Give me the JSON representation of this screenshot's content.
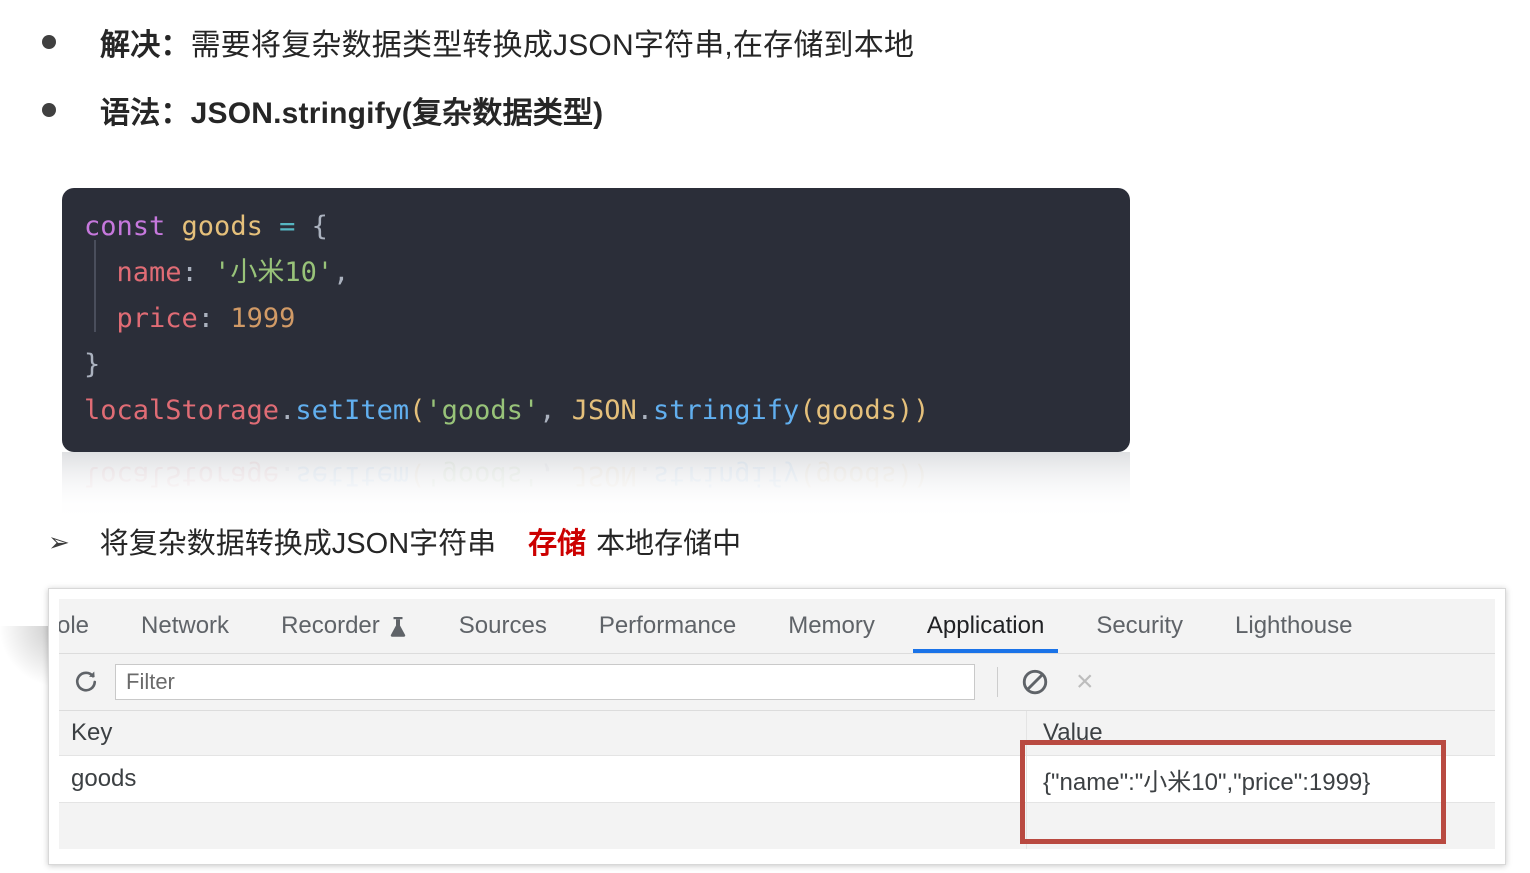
{
  "slide": {
    "bullets": [
      {
        "marker": "dot",
        "lead": "解决：",
        "rest": "需要将复杂数据类型转换成JSON字符串,在存储到本地",
        "bold_all": false
      },
      {
        "marker": "dot",
        "lead": "语法：",
        "rest": "JSON.stringify(复杂数据类型)",
        "bold_all": true
      }
    ],
    "sub_bullet": {
      "marker": "➢",
      "before": "将复杂数据转换成JSON字符串",
      "highlight": "存储",
      "highlight_color": "#CC0000",
      "after": "本地存储中"
    }
  },
  "code": {
    "language": "javascript",
    "background": "#2B2E39",
    "lines": [
      {
        "tokens": [
          {
            "t": "const",
            "c": "tok-kw"
          },
          {
            "t": " ",
            "c": "tok-punct"
          },
          {
            "t": "goods",
            "c": "tok-var"
          },
          {
            "t": " ",
            "c": "tok-punct"
          },
          {
            "t": "=",
            "c": "tok-op"
          },
          {
            "t": " ",
            "c": "tok-punct"
          },
          {
            "t": "{",
            "c": "tok-punct"
          }
        ]
      },
      {
        "tokens": [
          {
            "t": "  ",
            "c": "tok-punct"
          },
          {
            "t": "name",
            "c": "tok-prop"
          },
          {
            "t": ": ",
            "c": "tok-punct"
          },
          {
            "t": "'小米10'",
            "c": "tok-str"
          },
          {
            "t": ",",
            "c": "tok-punct"
          }
        ]
      },
      {
        "tokens": [
          {
            "t": "  ",
            "c": "tok-punct"
          },
          {
            "t": "price",
            "c": "tok-prop"
          },
          {
            "t": ": ",
            "c": "tok-punct"
          },
          {
            "t": "1999",
            "c": "tok-num"
          }
        ]
      },
      {
        "tokens": [
          {
            "t": "}",
            "c": "tok-punct"
          }
        ]
      },
      {
        "tokens": [
          {
            "t": "localStorage",
            "c": "tok-obj"
          },
          {
            "t": ".",
            "c": "tok-dot"
          },
          {
            "t": "setItem",
            "c": "tok-fn"
          },
          {
            "t": "(",
            "c": "tok-var"
          },
          {
            "t": "'goods'",
            "c": "tok-str"
          },
          {
            "t": ", ",
            "c": "tok-punct"
          },
          {
            "t": "JSON",
            "c": "tok-var"
          },
          {
            "t": ".",
            "c": "tok-dot"
          },
          {
            "t": "stringify",
            "c": "tok-fn"
          },
          {
            "t": "(",
            "c": "tok-var"
          },
          {
            "t": "goods",
            "c": "tok-var"
          },
          {
            "t": "))",
            "c": "tok-var"
          }
        ]
      }
    ],
    "reflection_line_index": 4
  },
  "devtools": {
    "tabs": [
      {
        "label": "ole",
        "active": false,
        "icon": null,
        "clipped": true
      },
      {
        "label": "Network",
        "active": false,
        "icon": null
      },
      {
        "label": "Recorder",
        "active": false,
        "icon": "flask-icon"
      },
      {
        "label": "Sources",
        "active": false,
        "icon": null
      },
      {
        "label": "Performance",
        "active": false,
        "icon": null
      },
      {
        "label": "Memory",
        "active": false,
        "icon": null
      },
      {
        "label": "Application",
        "active": true,
        "icon": null
      },
      {
        "label": "Security",
        "active": false,
        "icon": null
      },
      {
        "label": "Lighthouse",
        "active": false,
        "icon": null
      }
    ],
    "active_tab_underline_color": "#1a73e8",
    "toolbar": {
      "refresh_icon": "refresh-icon",
      "filter_placeholder": "Filter",
      "filter_value": "",
      "clear_icon": "block-circle-icon",
      "close_icon": "close-x-icon",
      "close_label": "×"
    },
    "storage_table": {
      "columns": [
        "Key",
        "Value"
      ],
      "rows": [
        {
          "key": "goods",
          "value": "{\"name\":\"小米10\",\"price\":1999}"
        }
      ],
      "empty_row": {
        "key": "",
        "value": ""
      }
    },
    "annotation": {
      "type": "rectangle",
      "color": "#B94A41",
      "targets": "Value column"
    }
  }
}
